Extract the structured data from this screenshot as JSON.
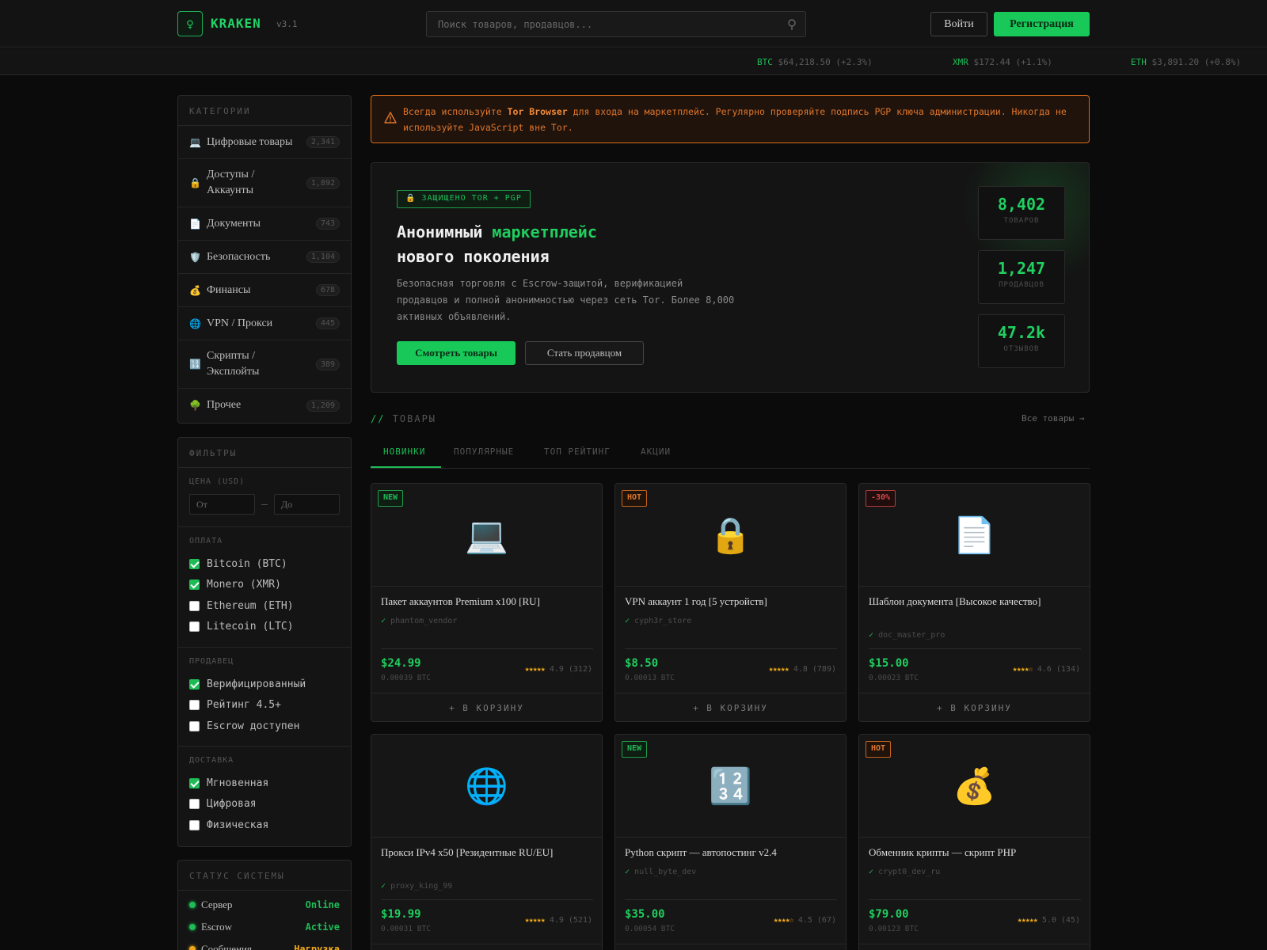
{
  "header": {
    "logo_glyph": "♀",
    "logo_text": "KRAKEN",
    "version": "v3.1",
    "search_placeholder": "Поиск товаров, продавцов...",
    "login_label": "Войти",
    "register_label": "Регистрация"
  },
  "ticker": [
    {
      "symbol": "BTC",
      "value": "$64,218.50 (+2.3%)"
    },
    {
      "symbol": "XMR",
      "value": "$172.44 (+1.1%)"
    },
    {
      "symbol": "ETH",
      "value": "$3,891.20 (+0.8%)"
    }
  ],
  "categories": {
    "title": "КАТЕГОРИИ",
    "items": [
      {
        "icon": "💻",
        "icon_name": "laptop-icon",
        "label": "Цифровые товары",
        "count": "2,341"
      },
      {
        "icon": "🔒",
        "icon_name": "lock-icon",
        "label": "Доступы / Аккаунты",
        "count": "1,892"
      },
      {
        "icon": "📄",
        "icon_name": "document-icon",
        "label": "Документы",
        "count": "743"
      },
      {
        "icon": "🛡️",
        "icon_name": "shield-icon",
        "label": "Безопасность",
        "count": "1,104"
      },
      {
        "icon": "💰",
        "icon_name": "money-bag-icon",
        "label": "Финансы",
        "count": "678"
      },
      {
        "icon": "🌐",
        "icon_name": "globe-icon",
        "label": "VPN / Прокси",
        "count": "445"
      },
      {
        "icon": "🔢",
        "icon_name": "numbers-icon",
        "label": "Скрипты / Эксплойты",
        "count": "389"
      },
      {
        "icon": "🌳",
        "icon_name": "tree-icon",
        "label": "Прочее",
        "count": "1,209"
      }
    ]
  },
  "filters": {
    "title": "ФИЛЬТРЫ",
    "price_label": "ЦЕНА (USD)",
    "price_from_placeholder": "От",
    "price_to_placeholder": "До",
    "price_dash": "—",
    "payment_label": "ОПЛАТА",
    "payment": [
      {
        "label": "Bitcoin (BTC)",
        "checked": true
      },
      {
        "label": "Monero (XMR)",
        "checked": true
      },
      {
        "label": "Ethereum (ETH)",
        "checked": false
      },
      {
        "label": "Litecoin (LTC)",
        "checked": false
      }
    ],
    "seller_label": "ПРОДАВЕЦ",
    "seller": [
      {
        "label": "Верифицированный",
        "checked": true
      },
      {
        "label": "Рейтинг 4.5+",
        "checked": false
      },
      {
        "label": "Escrow доступен",
        "checked": false
      }
    ],
    "delivery_label": "ДОСТАВКА",
    "delivery": [
      {
        "label": "Мгновенная",
        "checked": true
      },
      {
        "label": "Цифровая",
        "checked": false
      },
      {
        "label": "Физическая",
        "checked": false
      }
    ]
  },
  "system_status": {
    "title": "СТАТУС СИСТЕМЫ",
    "items": [
      {
        "name": "Сервер",
        "value": "Online",
        "color": "#1fbb57"
      },
      {
        "name": "Escrow",
        "value": "Active",
        "color": "#1fbb57"
      },
      {
        "name": "Сообщения",
        "value": "Нагрузка",
        "color": "#f0a818"
      }
    ]
  },
  "alert": {
    "prefix": "Всегда используйте ",
    "bold": "Tor Browser",
    "suffix": " для входа на маркетплейс. Регулярно проверяйте подпись PGP ключа администрации. Никогда не используйте JavaScript вне Tor."
  },
  "hero": {
    "badge": "🔒 ЗАЩИЩЕНО TOR + PGP",
    "title_part1": "Анонимный ",
    "title_highlight": "маркетплейс",
    "title_line2": "нового поколения",
    "description": "Безопасная торговля с Escrow-защитой, верификацией продавцов и полной анонимностью через сеть Tor. Более 8,000 активных объявлений.",
    "primary_button": "Смотреть товары",
    "secondary_button": "Стать продавцом",
    "stats": [
      {
        "value": "8,402",
        "label": "ТОВАРОВ"
      },
      {
        "value": "1,247",
        "label": "ПРОДАВЦОВ"
      },
      {
        "value": "47.2k",
        "label": "ОТЗЫВОВ"
      }
    ]
  },
  "products_section": {
    "slash": "//",
    "title": "ТОВАРЫ",
    "all_link": "Все товары →",
    "tabs": [
      "НОВИНКИ",
      "ПОПУЛЯРНЫЕ",
      "ТОП РЕЙТИНГ",
      "АКЦИИ"
    ],
    "active_tab": 0,
    "cart_label": "+ В КОРЗИНУ"
  },
  "products": [
    {
      "tag": "NEW",
      "tag_type": "new",
      "icon": "💻",
      "icon_name": "laptop-icon",
      "title": "Пакет аккаунтов Premium x100 [RU]",
      "seller": "phantom_vendor",
      "price": "$24.99",
      "btc": "0.00039 BTC",
      "stars": "★★★★★",
      "rating": "4.9 (312)"
    },
    {
      "tag": "HOT",
      "tag_type": "hot",
      "icon": "🔒",
      "icon_name": "lock-icon",
      "title": "VPN аккаунт 1 год [5 устройств]",
      "seller": "cyph3r_store",
      "price": "$8.50",
      "btc": "0.00013 BTC",
      "stars": "★★★★★",
      "rating": "4.8 (789)"
    },
    {
      "tag": "-30%",
      "tag_type": "sale",
      "icon": "📄",
      "icon_name": "document-icon",
      "title": "Шаблон документа [Высокое качество]",
      "seller": "doc_master_pro",
      "price": "$15.00",
      "btc": "0.00023 BTC",
      "stars": "★★★★☆",
      "rating": "4.6 (134)"
    },
    {
      "tag": "",
      "tag_type": "",
      "icon": "🌐",
      "icon_name": "globe-icon",
      "title": "Прокси IPv4 x50 [Резидентные RU/EU]",
      "seller": "proxy_king_99",
      "price": "$19.99",
      "btc": "0.00031 BTC",
      "stars": "★★★★★",
      "rating": "4.9 (521)"
    },
    {
      "tag": "NEW",
      "tag_type": "new",
      "icon": "🔢",
      "icon_name": "numbers-icon",
      "title": "Python скрипт — автопостинг v2.4",
      "seller": "null_byte_dev",
      "price": "$35.00",
      "btc": "0.00054 BTC",
      "stars": "★★★★☆",
      "rating": "4.5 (67)"
    },
    {
      "tag": "HOT",
      "tag_type": "hot",
      "icon": "💰",
      "icon_name": "money-bag-icon",
      "title": "Обменник крипты — скрипт PHP",
      "seller": "crypt0_dev_ru",
      "price": "$79.00",
      "btc": "0.00123 BTC",
      "stars": "★★★★★",
      "rating": "5.0 (45)"
    }
  ]
}
